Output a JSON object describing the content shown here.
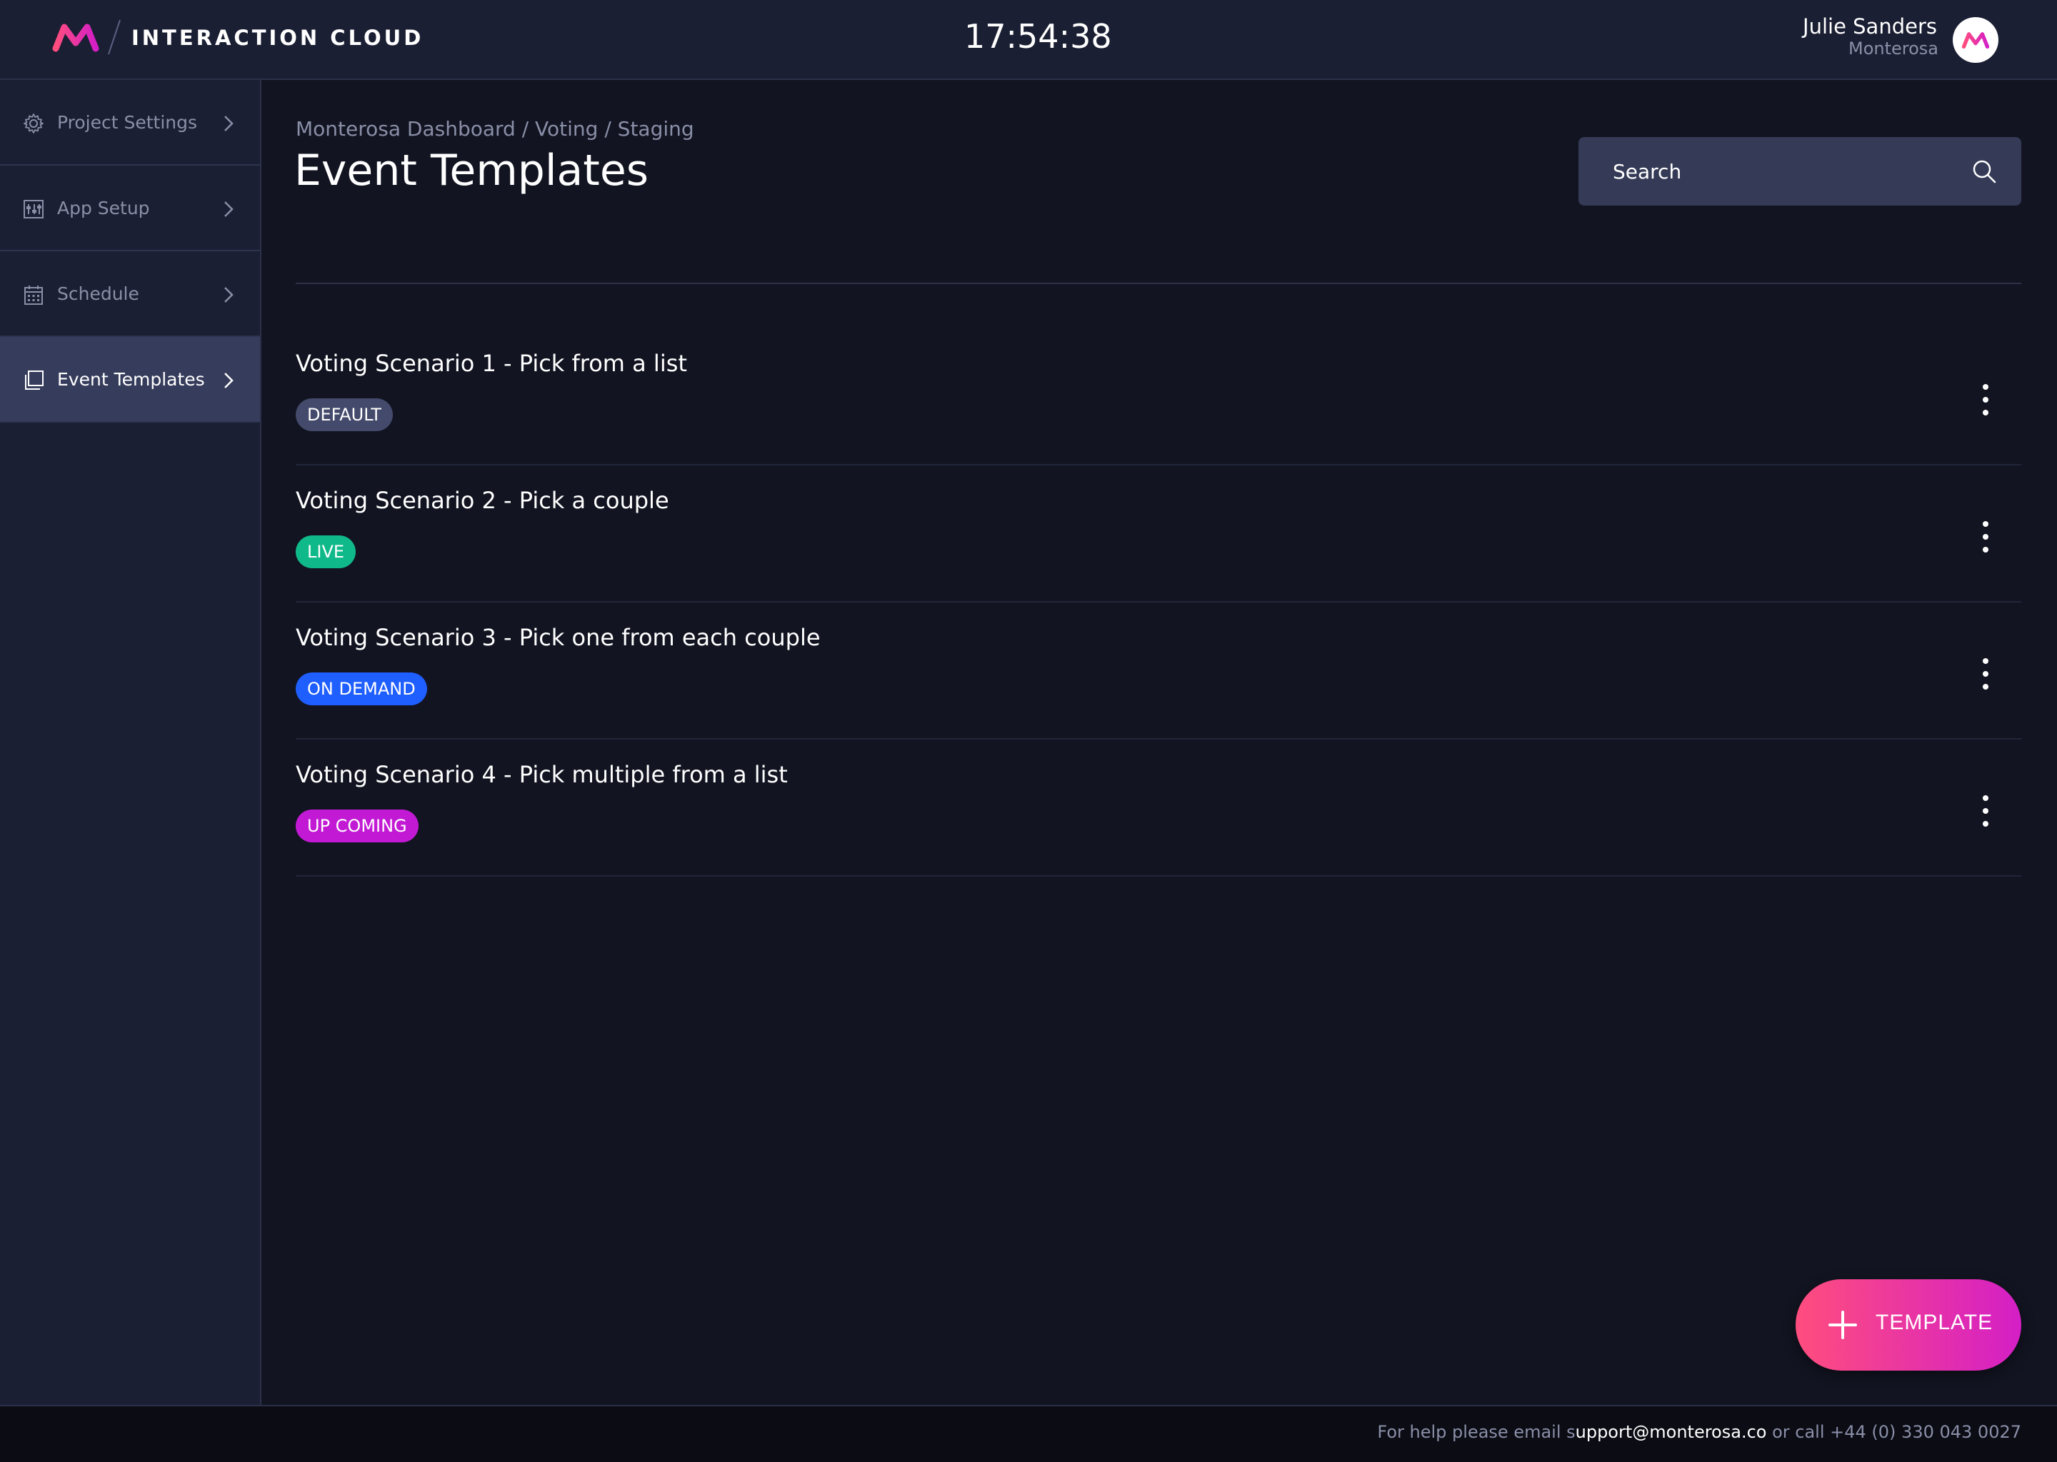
{
  "app": {
    "name": "INTERACTION CLOUD",
    "logo_icon": "monterosa-m-icon",
    "brand_colors": {
      "pink": "#ff4d7e",
      "magenta": "#d41fc6"
    }
  },
  "clock": "17:54:38",
  "user": {
    "name": "Julie Sanders",
    "org": "Monterosa"
  },
  "sidebar": {
    "items": [
      {
        "label": "Project Settings",
        "icon": "gear-icon",
        "active": false
      },
      {
        "label": "App Setup",
        "icon": "app-setup-icon",
        "active": false
      },
      {
        "label": "Schedule",
        "icon": "calendar-icon",
        "active": false
      },
      {
        "label": "Event Templates",
        "icon": "templates-icon",
        "active": true
      }
    ]
  },
  "breadcrumb": "Monterosa Dashboard / Voting / Staging",
  "page_title": "Event Templates",
  "search": {
    "placeholder": "Search",
    "value": ""
  },
  "templates": [
    {
      "title": "Voting Scenario 1 - Pick from a list",
      "badge": "DEFAULT",
      "badge_color": "#444a6b"
    },
    {
      "title": "Voting Scenario 2 - Pick a couple",
      "badge": "LIVE",
      "badge_color": "#10b98a"
    },
    {
      "title": "Voting Scenario 3 - Pick one from each couple",
      "badge": "ON DEMAND",
      "badge_color": "#1f5eff"
    },
    {
      "title": "Voting Scenario 4 - Pick multiple from a list",
      "badge": "UP COMING",
      "badge_color": "#c21ad4"
    }
  ],
  "fab": {
    "label": "TEMPLATE",
    "icon": "plus-icon"
  },
  "footer": {
    "prefix": "For help please email s",
    "email": "upport@monterosa.co",
    "suffix": " or call +44 (0) 330 043 0027"
  }
}
